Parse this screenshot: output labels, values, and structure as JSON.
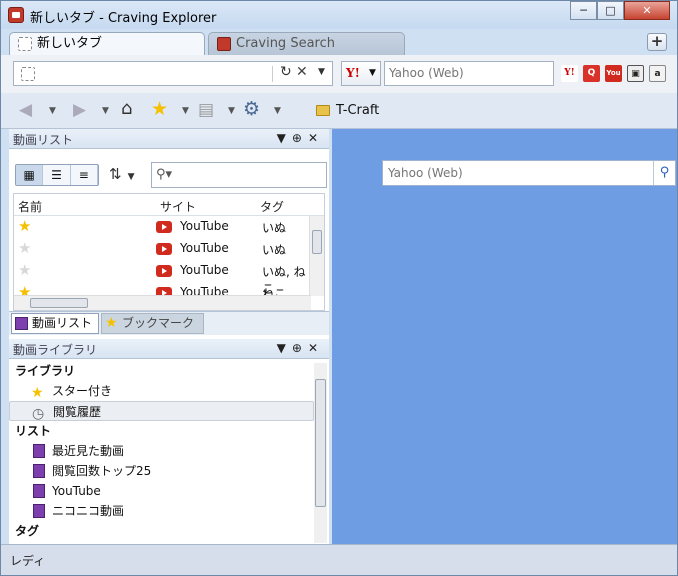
{
  "window": {
    "title": "新しいタブ - Craving Explorer"
  },
  "tabs": [
    {
      "label": "新しいタブ"
    },
    {
      "label": "Craving Search"
    }
  ],
  "address": {
    "value": "",
    "placeholder": ""
  },
  "search": {
    "placeholder": "Yahoo (Web)",
    "engine": "Y!"
  },
  "search_shortcuts": [
    "yahoo-icon",
    "search-icon",
    "youtube-icon",
    "nico-icon",
    "amazon-icon"
  ],
  "toolbar": {
    "bookmark_folder": "T-Craft"
  },
  "video_list_panel": {
    "title": "動画リスト",
    "filter_placeholder": "",
    "columns": [
      "名前",
      "サイト",
      "タグ"
    ],
    "rows": [
      {
        "starred": true,
        "site": "YouTube",
        "tag": "いぬ"
      },
      {
        "starred": false,
        "site": "YouTube",
        "tag": "いぬ"
      },
      {
        "starred": false,
        "site": "YouTube",
        "tag": "いぬ, ねこ"
      },
      {
        "starred": true,
        "site": "YouTube",
        "tag": "ねこ"
      }
    ],
    "tabs": [
      "動画リスト",
      "ブックマーク"
    ]
  },
  "library_panel": {
    "title": "動画ライブラリ",
    "groups": [
      {
        "header": "ライブラリ",
        "items": [
          "スター付き",
          "閲覧履歴"
        ]
      },
      {
        "header": "リスト",
        "items": [
          "最近見た動画",
          "閲覧回数トップ25",
          "YouTube",
          "ニコニコ動画"
        ]
      },
      {
        "header": "タグ",
        "items": []
      }
    ]
  },
  "content_search": {
    "placeholder": "Yahoo (Web)"
  },
  "status": {
    "text": "レディ"
  },
  "colors": {
    "content_bg": "#6f9de4",
    "accent": "#c0392b"
  }
}
